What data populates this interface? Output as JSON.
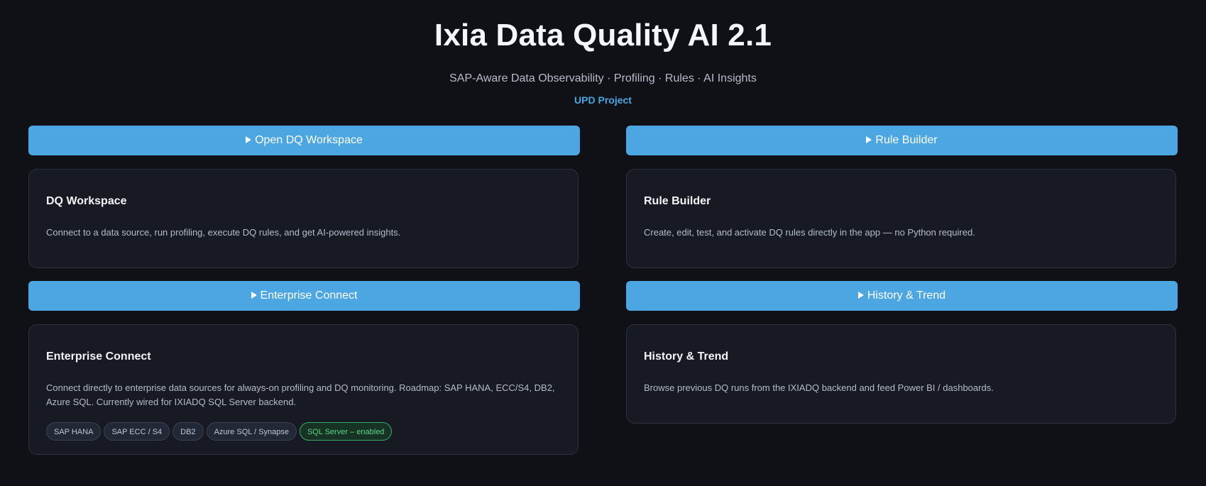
{
  "header": {
    "title": "Ixia Data Quality AI 2.1",
    "subtitle": "SAP-Aware Data Observability · Profiling · Rules · AI Insights",
    "project": "UPD Project"
  },
  "sections": [
    {
      "button_label": "Open DQ Workspace",
      "card_title": "DQ Workspace",
      "card_desc": "Connect to a data source, run profiling, execute DQ rules, and get AI-powered insights."
    },
    {
      "button_label": "Rule Builder",
      "card_title": "Rule Builder",
      "card_desc": "Create, edit, test, and activate DQ rules directly in the app — no Python required."
    },
    {
      "button_label": "Enterprise Connect",
      "card_title": "Enterprise Connect",
      "card_desc": "Connect directly to enterprise data sources for always-on profiling and DQ monitoring. Roadmap: SAP HANA, ECC/S4, DB2, Azure SQL. Currently wired for IXIADQ SQL Server backend.",
      "tags": [
        "SAP HANA",
        "SAP ECC / S4",
        "DB2",
        "Azure SQL / Synapse",
        "SQL Server – enabled"
      ]
    },
    {
      "button_label": "History & Trend",
      "card_title": "History & Trend",
      "card_desc": "Browse previous DQ runs from the IXIADQ backend and feed Power BI / dashboards."
    }
  ],
  "colors": {
    "background": "#0f1117",
    "button": "#4ba6e1",
    "card": "#171a22",
    "accent": "#4aa6e2",
    "enabled": "#57d683"
  },
  "icons": {
    "button_icon": "play-icon"
  }
}
